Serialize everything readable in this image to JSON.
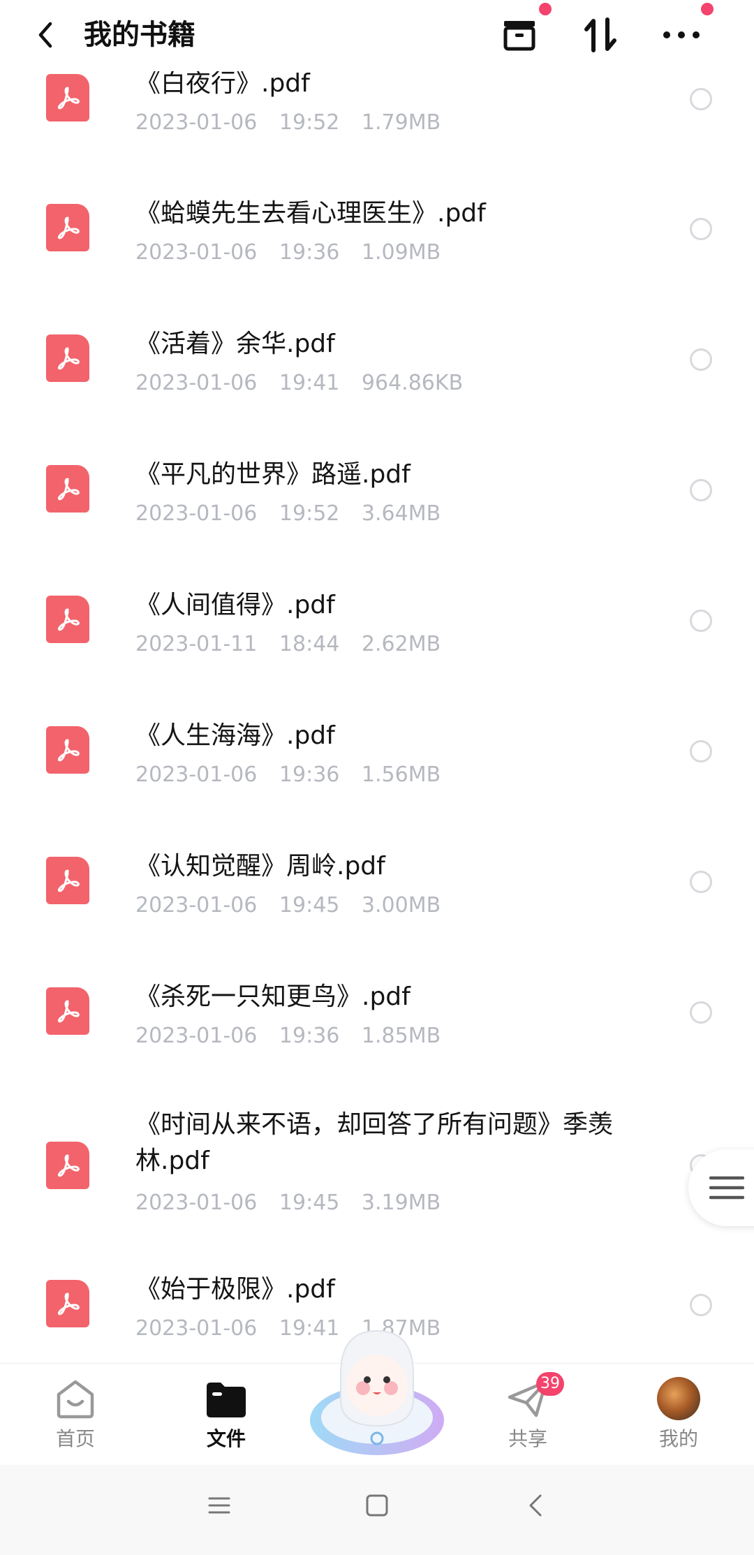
{
  "header": {
    "title": "我的书籍",
    "back_icon": "chevron-left-icon",
    "actions": [
      "archive-icon",
      "sort-icon",
      "more-icon"
    ],
    "accent": "#f4436c"
  },
  "files": [
    {
      "name": "《白夜行》.pdf",
      "date": "2023-01-06",
      "time": "19:52",
      "size": "1.79MB"
    },
    {
      "name": "《蛤蟆先生去看心理医生》.pdf",
      "date": "2023-01-06",
      "time": "19:36",
      "size": "1.09MB"
    },
    {
      "name": "《活着》余华.pdf",
      "date": "2023-01-06",
      "time": "19:41",
      "size": "964.86KB"
    },
    {
      "name": "《平凡的世界》路遥.pdf",
      "date": "2023-01-06",
      "time": "19:52",
      "size": "3.64MB"
    },
    {
      "name": "《人间值得》.pdf",
      "date": "2023-01-11",
      "time": "18:44",
      "size": "2.62MB"
    },
    {
      "name": "《人生海海》.pdf",
      "date": "2023-01-06",
      "time": "19:36",
      "size": "1.56MB"
    },
    {
      "name": "《认知觉醒》周岭.pdf",
      "date": "2023-01-06",
      "time": "19:45",
      "size": "3.00MB"
    },
    {
      "name": "《杀死一只知更鸟》.pdf",
      "date": "2023-01-06",
      "time": "19:36",
      "size": "1.85MB"
    },
    {
      "name": "《时间从来不语，却回答了所有问题》季羡林.pdf",
      "date": "2023-01-06",
      "time": "19:45",
      "size": "3.19MB"
    },
    {
      "name": "《始于极限》.pdf",
      "date": "2023-01-06",
      "time": "19:41",
      "size": "1.87MB"
    }
  ],
  "bottom_nav": {
    "items": [
      {
        "label": "首页",
        "icon": "home-icon"
      },
      {
        "label": "文件",
        "icon": "folder-icon",
        "active": true
      },
      {
        "label": "共享",
        "icon": "send-icon",
        "badge": "39"
      },
      {
        "label": "我的",
        "icon": "avatar"
      }
    ]
  }
}
